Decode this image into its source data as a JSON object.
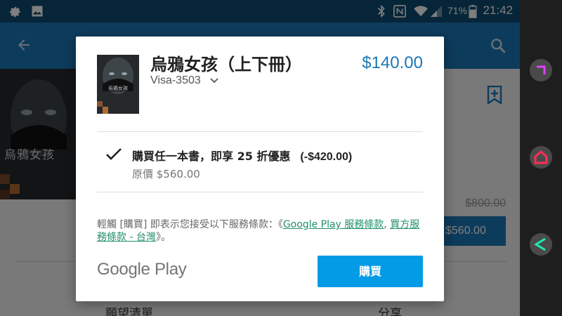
{
  "status_bar": {
    "battery": "71%",
    "time": "21:42"
  },
  "background": {
    "cover_title": "烏鴉女孩",
    "old_price": "$800.00",
    "price_button": "$560.00",
    "wishlist_label": "願望清單",
    "share_label": "分享"
  },
  "dialog": {
    "book_title": "烏鴉女孩（上下冊）",
    "price": "$140.00",
    "payment_method": "Visa-3503",
    "promo_text": "購買任一本書，即享 25 折優惠",
    "promo_amount": "(-$420.00)",
    "original_price": "原價 $560.00",
    "terms_prefix": "輕觸 [購買] 即表示您接受以下服務條款：《",
    "terms_link1": "Google Play 服務條款",
    "terms_sep": ", ",
    "terms_link2": "買方服務條款 - 台灣",
    "terms_suffix": "》。",
    "brand": "Google Play",
    "buy_label": "購買"
  },
  "colors": {
    "status_bar": "#0d4a73",
    "app_bar": "#1b77b7",
    "price_accent": "#1b77b7",
    "buy_button": "#039be5",
    "link": "#1e8f6a"
  },
  "icons": [
    "settings-icon",
    "image-icon",
    "bluetooth-icon",
    "nfc-icon",
    "wifi-icon",
    "signal-icon",
    "battery-icon",
    "back-arrow-icon",
    "search-icon",
    "wishlist-icon",
    "chevron-down-icon",
    "check-icon"
  ]
}
